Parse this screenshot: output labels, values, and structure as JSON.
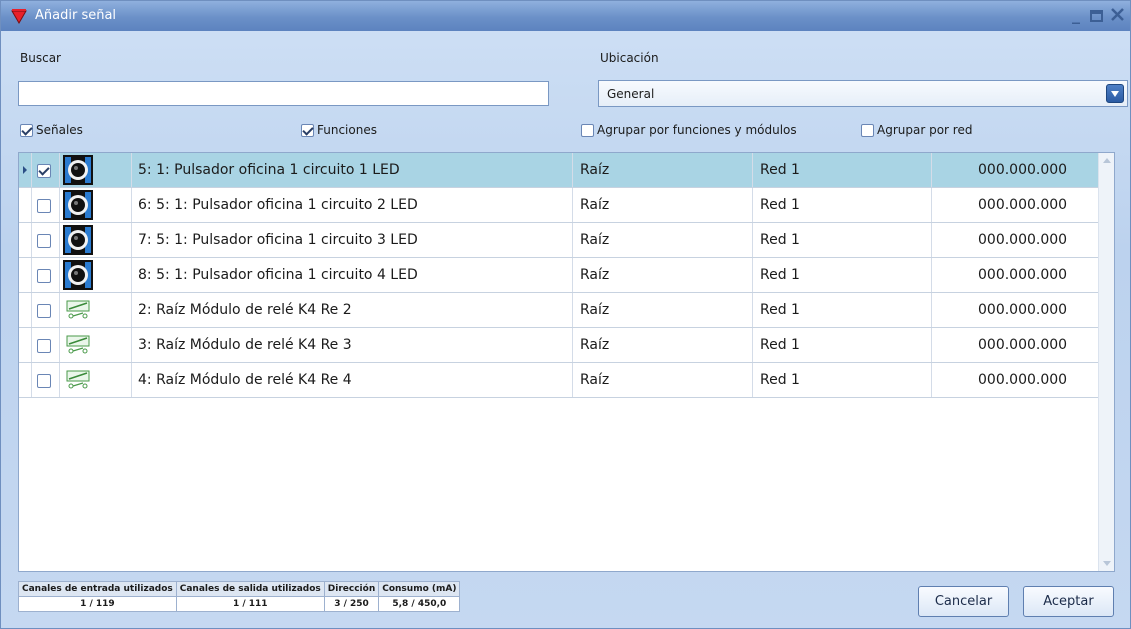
{
  "window": {
    "title": "Añadir señal"
  },
  "search": {
    "label": "Buscar",
    "value": ""
  },
  "location": {
    "label": "Ubicación",
    "value": "General"
  },
  "options": {
    "senales": {
      "label": "Señales",
      "checked": true
    },
    "funciones": {
      "label": "Funciones",
      "checked": true
    },
    "agrupar_funciones": {
      "label": "Agrupar por funciones y módulos",
      "checked": false
    },
    "agrupar_red": {
      "label": "Agrupar por red",
      "checked": false
    }
  },
  "rows": [
    {
      "icon": "pushbutton-icon",
      "checked": true,
      "selected": true,
      "name": "5: 1: Pulsador oficina 1 circuito 1 LED",
      "location": "Raíz",
      "network": "Red 1",
      "address": "000.000.000"
    },
    {
      "icon": "pushbutton-icon",
      "checked": false,
      "selected": false,
      "name": "6: 5: 1: Pulsador oficina 1 circuito 2 LED",
      "location": "Raíz",
      "network": "Red 1",
      "address": "000.000.000"
    },
    {
      "icon": "pushbutton-icon",
      "checked": false,
      "selected": false,
      "name": "7: 5: 1: Pulsador oficina 1 circuito 3 LED",
      "location": "Raíz",
      "network": "Red 1",
      "address": "000.000.000"
    },
    {
      "icon": "pushbutton-icon",
      "checked": false,
      "selected": false,
      "name": "8: 5: 1: Pulsador oficina 1 circuito 4 LED",
      "location": "Raíz",
      "network": "Red 1",
      "address": "000.000.000"
    },
    {
      "icon": "relay-icon",
      "checked": false,
      "selected": false,
      "name": "2: Raíz Módulo de relé K4 Re 2",
      "location": "Raíz",
      "network": "Red 1",
      "address": "000.000.000"
    },
    {
      "icon": "relay-icon",
      "checked": false,
      "selected": false,
      "name": "3: Raíz Módulo de relé K4 Re 3",
      "location": "Raíz",
      "network": "Red 1",
      "address": "000.000.000"
    },
    {
      "icon": "relay-icon",
      "checked": false,
      "selected": false,
      "name": "4: Raíz Módulo de relé K4 Re 4",
      "location": "Raíz",
      "network": "Red 1",
      "address": "000.000.000"
    }
  ],
  "stats": {
    "headers": [
      "Canales de entrada utilizados",
      "Canales de salida utilizados",
      "Dirección",
      "Consumo (mA)"
    ],
    "values": [
      "1 / 119",
      "1 / 111",
      "3 / 250",
      "5,8 / 450,0"
    ]
  },
  "buttons": {
    "cancel": "Cancelar",
    "accept": "Aceptar"
  },
  "colors": {
    "selected_row": "#a9d4e4",
    "title_bar": "#6b90c8",
    "app_icon": "#e8202a"
  }
}
